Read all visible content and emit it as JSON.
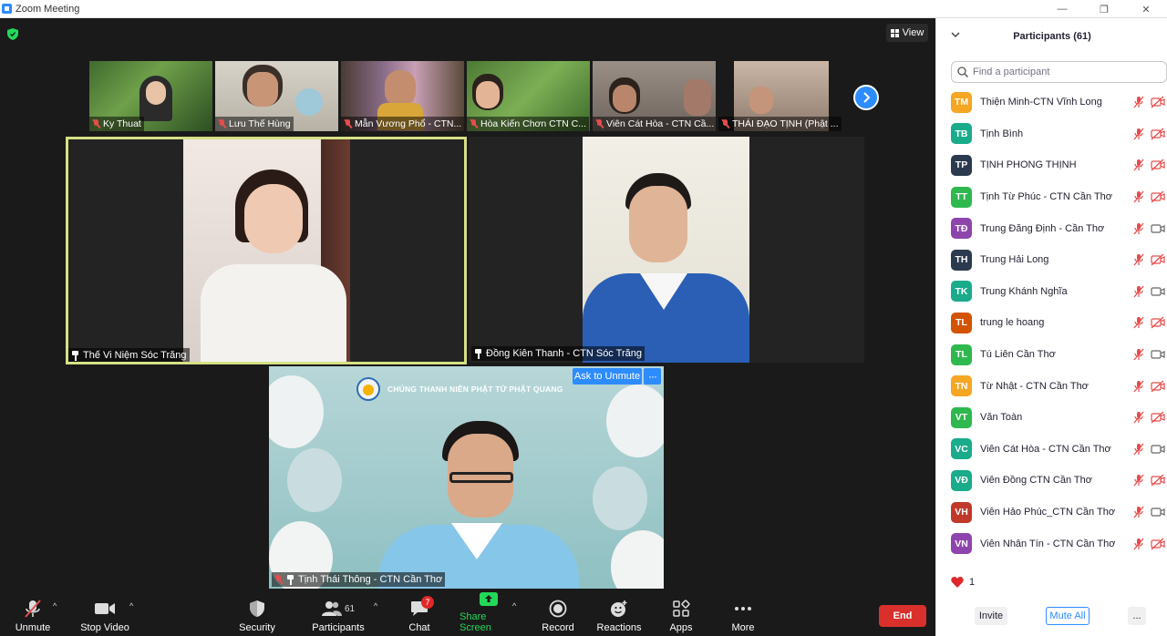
{
  "window": {
    "title": "Zoom Meeting"
  },
  "view_button": {
    "label": "View"
  },
  "thumbnails": [
    {
      "name": "Ky Thuat"
    },
    {
      "name": "Lưu Thế Hùng"
    },
    {
      "name": "Mẫn Vương Phổ - CTN..."
    },
    {
      "name": "Hòa Kiến Chơn CTN C..."
    },
    {
      "name": "Viên Cát Hòa - CTN Cầ..."
    },
    {
      "name": "THÁI ĐẠO TỊNH (Phật ..."
    }
  ],
  "tiles": {
    "left": {
      "name": "Thế Vi Niệm Sóc Trăng"
    },
    "right": {
      "name": "Đồng Kiên Thanh - CTN Sóc Trăng"
    },
    "bottom": {
      "name": "Tịnh Thái Thông - CTN Cần Thơ",
      "banner_text": "CHÚNG THANH NIÊN PHẬT TỬ PHẬT QUANG",
      "ask_unmute_label": "Ask to Unmute",
      "more_label": "···"
    }
  },
  "toolbar": {
    "unmute": "Unmute",
    "stop_video": "Stop Video",
    "security": "Security",
    "participants": "Participants",
    "participants_count": "61",
    "chat": "Chat",
    "chat_badge": "7",
    "share_screen": "Share Screen",
    "record": "Record",
    "reactions": "Reactions",
    "apps": "Apps",
    "more": "More",
    "end": "End"
  },
  "panel": {
    "title": "Participants (61)",
    "search_placeholder": "Find a participant",
    "participants": [
      {
        "initials": "TM",
        "name": "Thiện Minh-CTN Vĩnh Long",
        "color": "#f5a623",
        "video_on": false
      },
      {
        "initials": "TB",
        "name": "Tịnh Bình",
        "color": "#1aab8b",
        "video_on": false
      },
      {
        "initials": "TP",
        "name": "TỊNH PHONG THỊNH",
        "color": "#2b3a4e",
        "video_on": false
      },
      {
        "initials": "TT",
        "name": "Tịnh Từ Phúc - CTN Cần Thơ",
        "color": "#2fb84e",
        "video_on": false
      },
      {
        "initials": "TĐ",
        "name": "Trung Đăng Định - Cần Thơ",
        "color": "#8e44ad",
        "video_on": true
      },
      {
        "initials": "TH",
        "name": "Trung Hải Long",
        "color": "#2b3a4e",
        "video_on": false
      },
      {
        "initials": "TK",
        "name": "Trung Khánh Nghĩa",
        "color": "#1aab8b",
        "video_on": true
      },
      {
        "initials": "TL",
        "name": "trung le hoang",
        "color": "#d35400",
        "video_on": false
      },
      {
        "initials": "TL",
        "name": "Tú Liên Cần Thơ",
        "color": "#2fb84e",
        "video_on": true
      },
      {
        "initials": "TN",
        "name": "Từ Nhật - CTN Cần Thơ",
        "color": "#f5a623",
        "video_on": false
      },
      {
        "initials": "VT",
        "name": "Văn Toàn",
        "color": "#2fb84e",
        "video_on": false
      },
      {
        "initials": "VC",
        "name": "Viên Cát Hòa - CTN Cần Thơ",
        "color": "#1aab8b",
        "video_on": true
      },
      {
        "initials": "VĐ",
        "name": "Viên Đồng CTN Cần Thơ",
        "color": "#1aab8b",
        "video_on": false
      },
      {
        "initials": "VH",
        "name": "Viên Hảo Phúc_CTN Cần Thơ",
        "color": "#c0392b",
        "video_on": true
      },
      {
        "initials": "VN",
        "name": "Viên Nhân Tín - CTN Cần Thơ",
        "color": "#8e44ad",
        "video_on": false
      }
    ],
    "reaction_count": "1",
    "invite": "Invite",
    "mute_all": "Mute All",
    "more": "..."
  },
  "colors": {
    "accent": "#2d8cff",
    "end": "#d9302c",
    "muted": "#e54d4d",
    "active_speaker": "#d6e084"
  }
}
